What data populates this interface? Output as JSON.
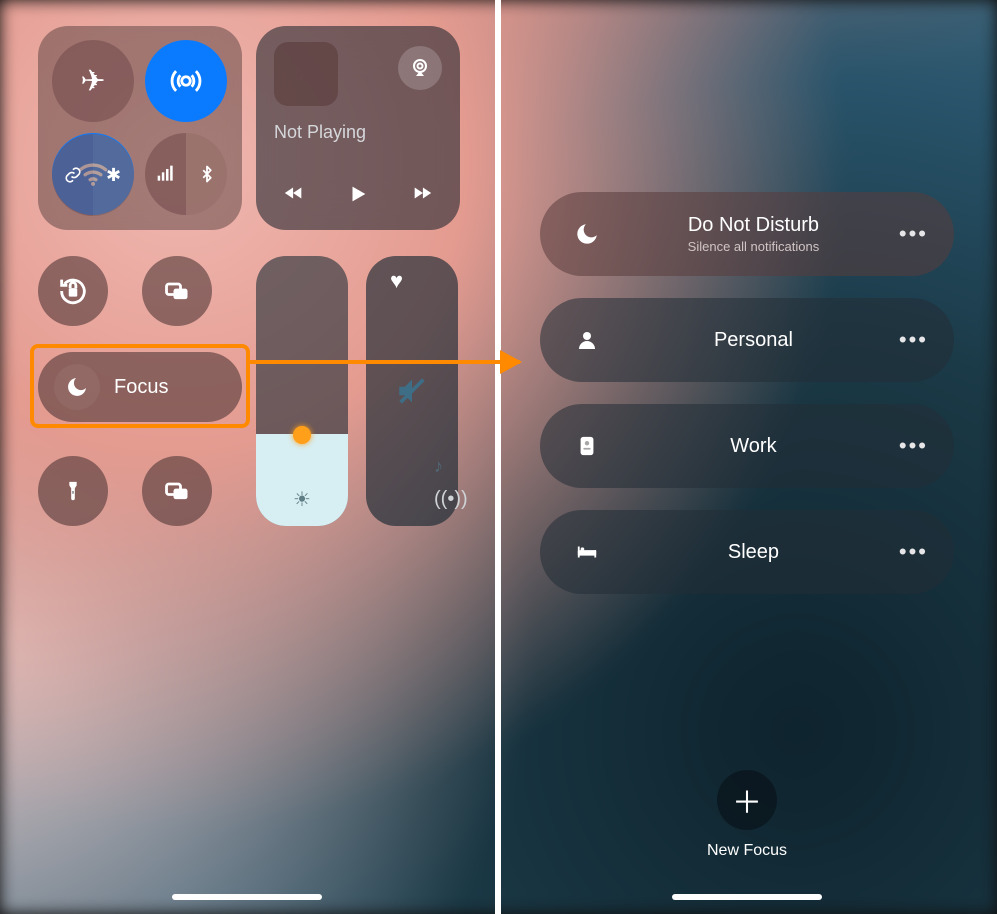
{
  "left": {
    "connectivity": {
      "airplane": "off",
      "airdrop": "on",
      "wifi": "on",
      "cellular_bt": {
        "cellular": "off",
        "bluetooth": "off"
      }
    },
    "nowplaying": {
      "title": "Not Playing"
    },
    "focus_label": "Focus"
  },
  "right": {
    "focus_modes": [
      {
        "icon": "moon",
        "title": "Do Not Disturb",
        "subtitle": "Silence all notifications"
      },
      {
        "icon": "person",
        "title": "Personal",
        "subtitle": ""
      },
      {
        "icon": "badge",
        "title": "Work",
        "subtitle": ""
      },
      {
        "icon": "bed",
        "title": "Sleep",
        "subtitle": ""
      }
    ],
    "new_focus_label": "New Focus"
  },
  "annotation": {
    "highlight_color": "#ff8a00"
  }
}
